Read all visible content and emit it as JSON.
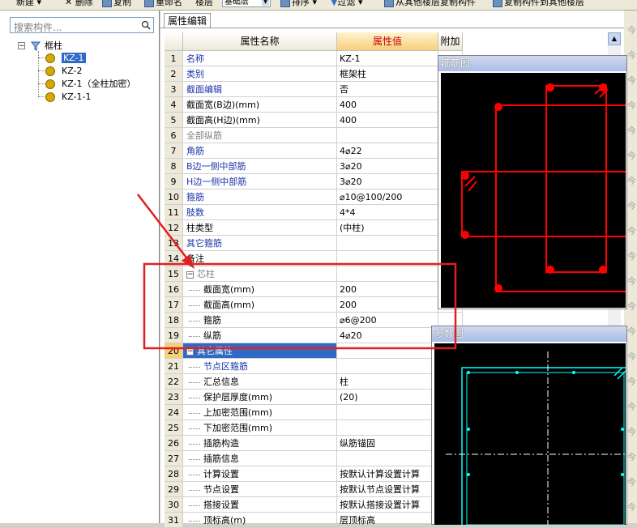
{
  "toolbar": {
    "items": [
      "新建",
      "删除",
      "复制",
      "重命名",
      "楼层",
      "排序",
      "过滤",
      "从其他楼层复制构件",
      "复制构件到其他楼层"
    ],
    "floor_value": "基础层"
  },
  "left": {
    "search_placeholder": "搜索构件...",
    "tree": {
      "root": "框柱",
      "items": [
        "KZ-1",
        "KZ-2",
        "KZ-1（全柱加密）",
        "KZ-1-1"
      ]
    }
  },
  "tab": "属性编辑",
  "grid": {
    "headers": [
      "属性名称",
      "属性值",
      "附加"
    ],
    "rows": [
      {
        "n": "1",
        "name": "名称",
        "value": "KZ-1",
        "style": "blue"
      },
      {
        "n": "2",
        "name": "类别",
        "value": "框架柱",
        "style": "blue"
      },
      {
        "n": "3",
        "name": "截面编辑",
        "value": "否",
        "style": "blue"
      },
      {
        "n": "4",
        "name": "截面宽(B边)(mm)",
        "value": "400",
        "style": "black"
      },
      {
        "n": "5",
        "name": "截面高(H边)(mm)",
        "value": "400",
        "style": "black"
      },
      {
        "n": "6",
        "name": "全部纵筋",
        "value": "",
        "style": "gray"
      },
      {
        "n": "7",
        "name": "角筋",
        "value": "4⌀22",
        "style": "blue"
      },
      {
        "n": "8",
        "name": "B边一侧中部筋",
        "value": "3⌀20",
        "style": "blue"
      },
      {
        "n": "9",
        "name": "H边一侧中部筋",
        "value": "3⌀20",
        "style": "blue"
      },
      {
        "n": "10",
        "name": "箍筋",
        "value": "⌀10@100/200",
        "style": "blue"
      },
      {
        "n": "11",
        "name": "肢数",
        "value": "4*4",
        "style": "blue"
      },
      {
        "n": "12",
        "name": "柱类型",
        "value": "(中柱)",
        "style": "black"
      },
      {
        "n": "13",
        "name": "其它箍筋",
        "value": "",
        "style": "blue"
      },
      {
        "n": "14",
        "name": "备注",
        "value": "",
        "style": "black"
      },
      {
        "n": "15",
        "name": "芯柱",
        "value": "",
        "style": "gray",
        "group": true
      },
      {
        "n": "16",
        "name": "截面宽(mm)",
        "value": "200",
        "style": "black",
        "child": true
      },
      {
        "n": "17",
        "name": "截面高(mm)",
        "value": "200",
        "style": "black",
        "child": true
      },
      {
        "n": "18",
        "name": "箍筋",
        "value": "⌀6@200",
        "style": "black",
        "child": true
      },
      {
        "n": "19",
        "name": "纵筋",
        "value": "4⌀20",
        "style": "black",
        "child": true
      },
      {
        "n": "20",
        "name": "其它属性",
        "value": "",
        "style": "black",
        "group": true,
        "selected": true
      },
      {
        "n": "21",
        "name": "节点区箍筋",
        "value": "",
        "style": "blue",
        "child": true
      },
      {
        "n": "22",
        "name": "汇总信息",
        "value": "柱",
        "style": "black",
        "child": true
      },
      {
        "n": "23",
        "name": "保护层厚度(mm)",
        "value": "(20)",
        "style": "black",
        "child": true
      },
      {
        "n": "24",
        "name": "上加密范围(mm)",
        "value": "",
        "style": "black",
        "child": true
      },
      {
        "n": "25",
        "name": "下加密范围(mm)",
        "value": "",
        "style": "black",
        "child": true
      },
      {
        "n": "26",
        "name": "插筋构造",
        "value": "纵筋锚固",
        "style": "black",
        "child": true
      },
      {
        "n": "27",
        "name": "插筋信息",
        "value": "",
        "style": "black",
        "child": true
      },
      {
        "n": "28",
        "name": "计算设置",
        "value": "按默认计算设置计算",
        "style": "black",
        "child": true
      },
      {
        "n": "29",
        "name": "节点设置",
        "value": "按默认节点设置计算",
        "style": "black",
        "child": true
      },
      {
        "n": "30",
        "name": "搭接设置",
        "value": "按默认搭接设置计算",
        "style": "black",
        "child": true
      },
      {
        "n": "31",
        "name": "顶标高(m)",
        "value": "层顶标高",
        "style": "black",
        "child": true
      }
    ]
  },
  "windows": {
    "stirrup_title": "箍筋图",
    "param_title": "参数图"
  },
  "right_strip_char": "今",
  "colors": {
    "rebar": "#ff0000",
    "param": "#00ffff",
    "selection": "#316ac5",
    "annotation": "#ff0000"
  }
}
